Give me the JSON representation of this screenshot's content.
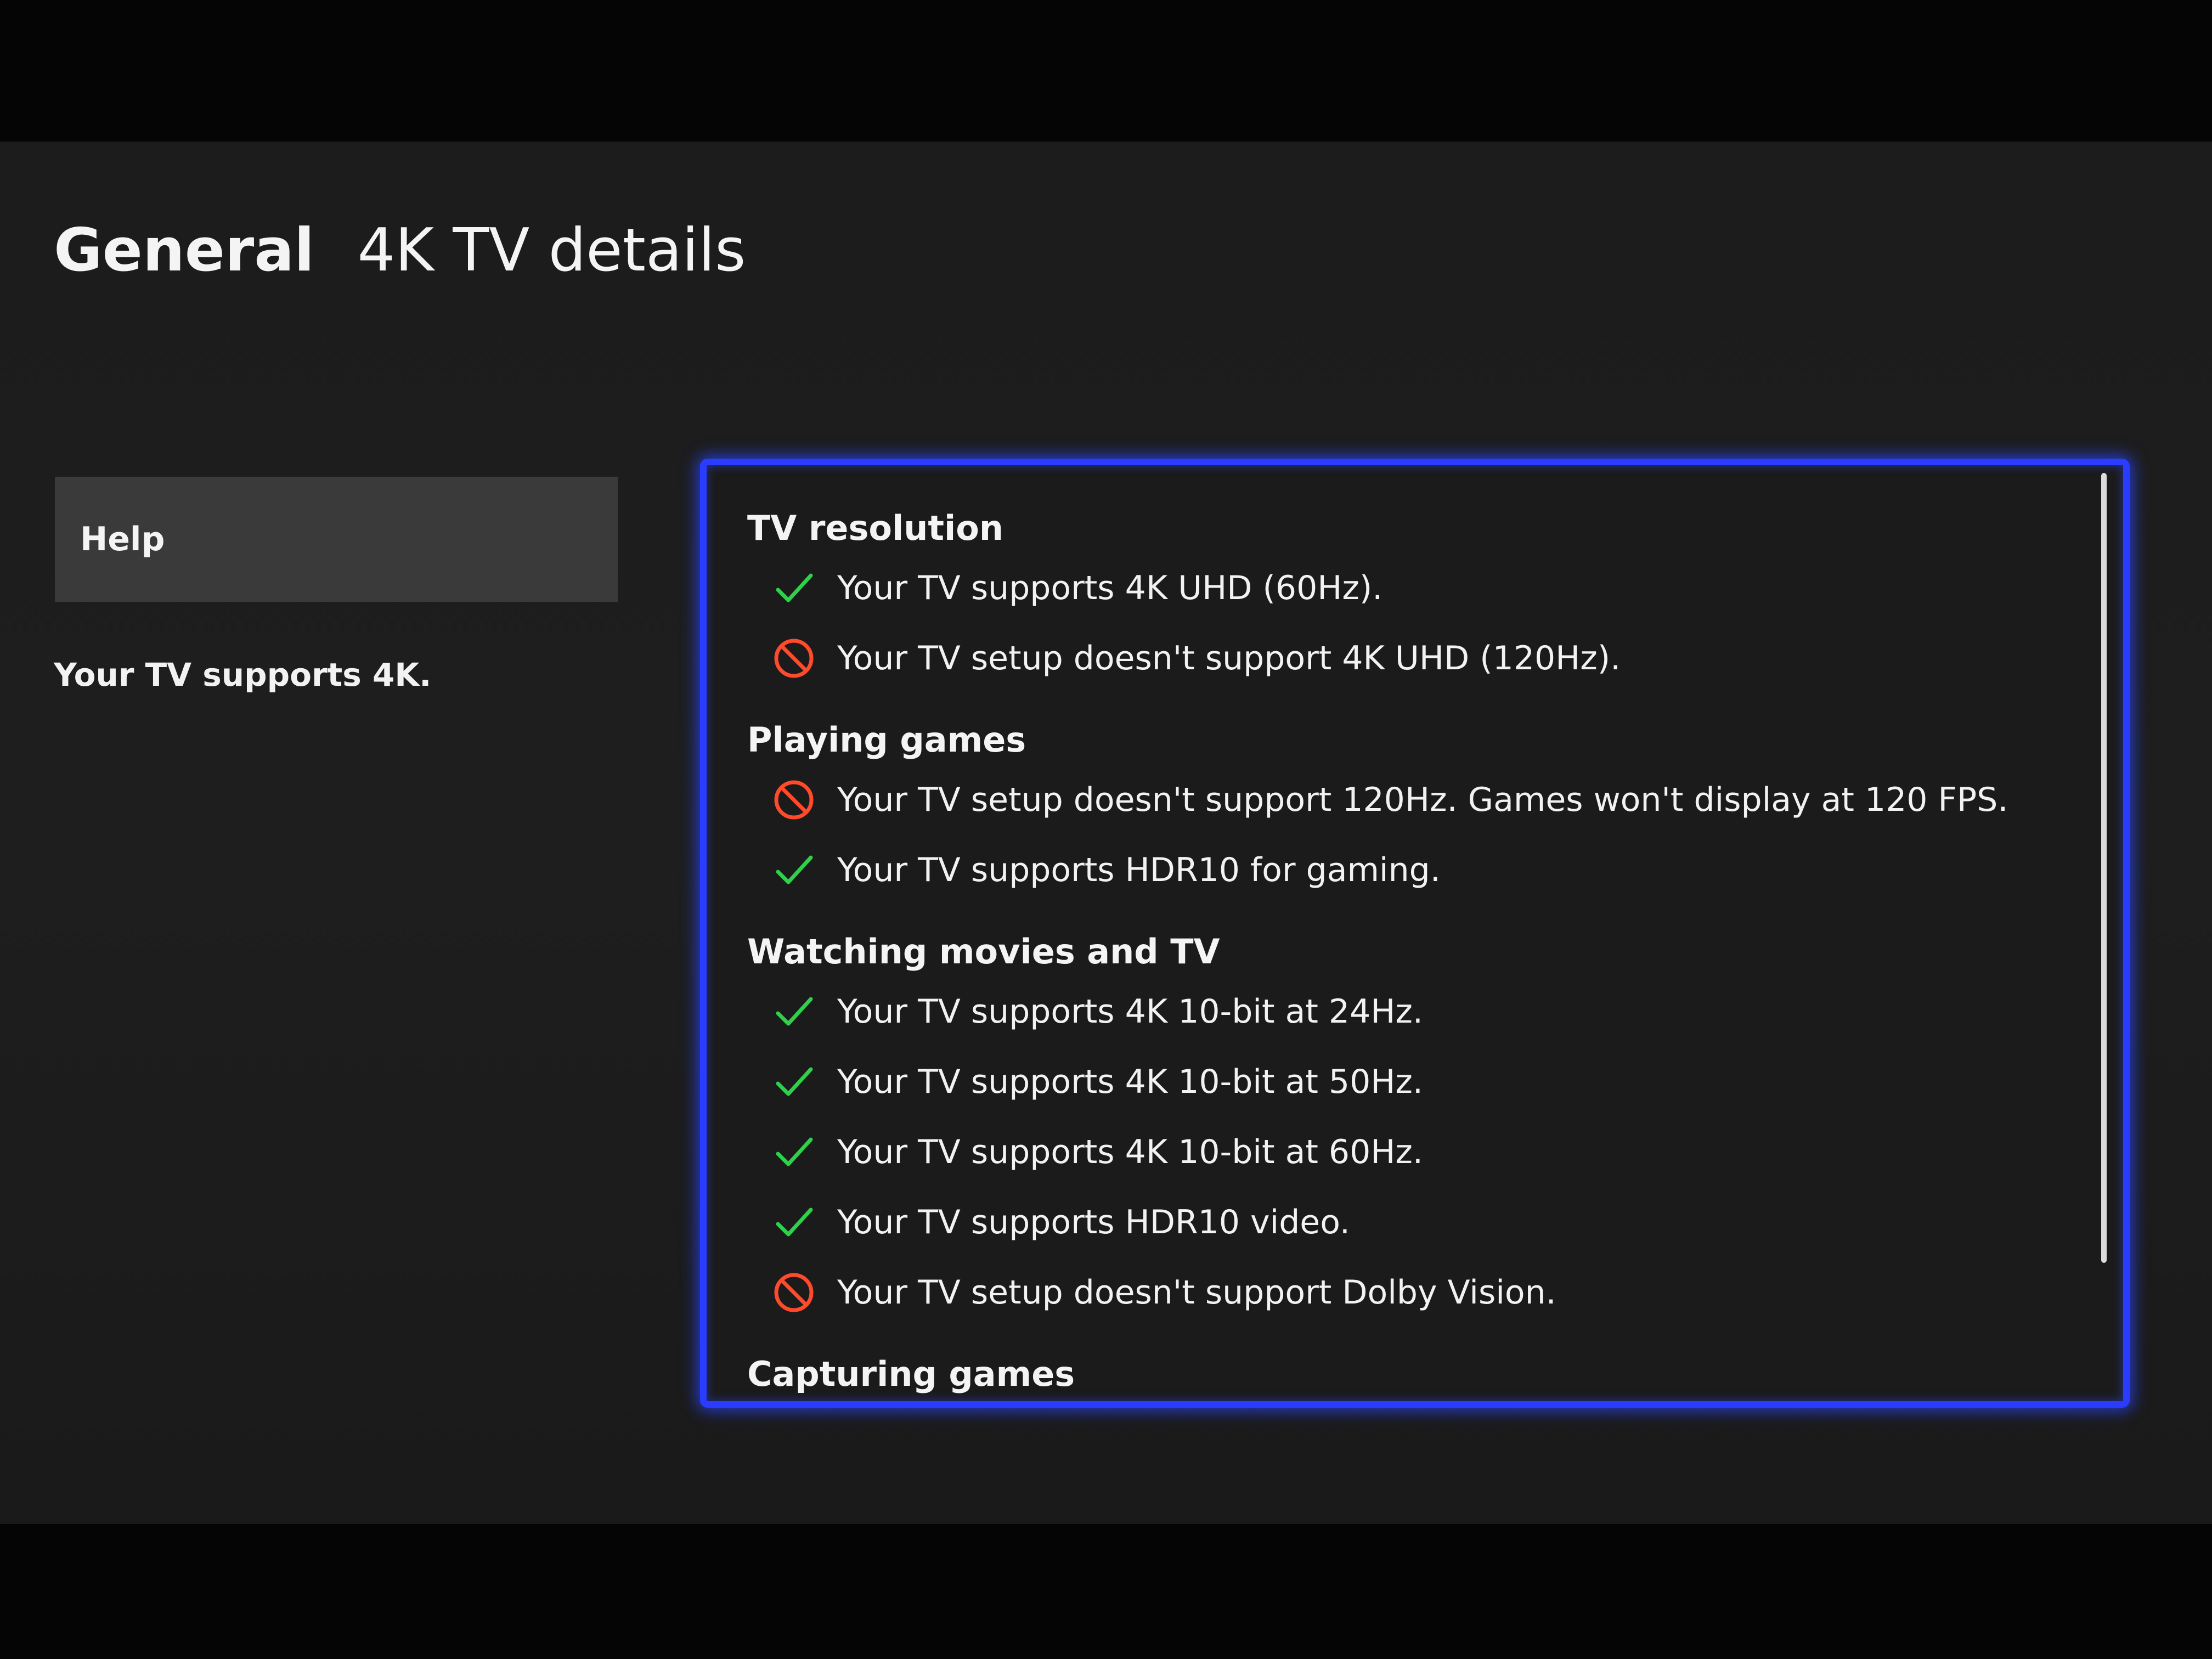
{
  "header": {
    "section": "General",
    "page_title": "4K TV details"
  },
  "sidebar": {
    "help_label": "Help",
    "status_summary": "Your TV supports 4K."
  },
  "details": {
    "sections": [
      {
        "title": "TV resolution",
        "items": [
          {
            "status": "supported",
            "icon": "check-icon",
            "text": "Your TV supports 4K UHD (60Hz)."
          },
          {
            "status": "unsupported",
            "icon": "not-supported-icon",
            "text": "Your TV setup doesn't support 4K UHD (120Hz)."
          }
        ]
      },
      {
        "title": "Playing games",
        "items": [
          {
            "status": "unsupported",
            "icon": "not-supported-icon",
            "text": "Your TV setup doesn't support 120Hz. Games won't display at 120 FPS."
          },
          {
            "status": "supported",
            "icon": "check-icon",
            "text": "Your TV supports HDR10 for gaming."
          }
        ]
      },
      {
        "title": "Watching movies and TV",
        "items": [
          {
            "status": "supported",
            "icon": "check-icon",
            "text": "Your TV supports 4K 10-bit at 24Hz."
          },
          {
            "status": "supported",
            "icon": "check-icon",
            "text": "Your TV supports 4K 10-bit at 50Hz."
          },
          {
            "status": "supported",
            "icon": "check-icon",
            "text": "Your TV supports 4K 10-bit at 60Hz."
          },
          {
            "status": "supported",
            "icon": "check-icon",
            "text": "Your TV supports HDR10 video."
          },
          {
            "status": "unsupported",
            "icon": "not-supported-icon",
            "text": "Your TV setup doesn't support Dolby Vision."
          }
        ]
      },
      {
        "title": "Capturing games",
        "items": []
      }
    ]
  },
  "colors": {
    "supported": "#2fd04a",
    "unsupported": "#ff4b2b",
    "focus_border": "#2a3cff",
    "button_background": "#3a3a3a",
    "screen_background": "#1d1d1d"
  }
}
